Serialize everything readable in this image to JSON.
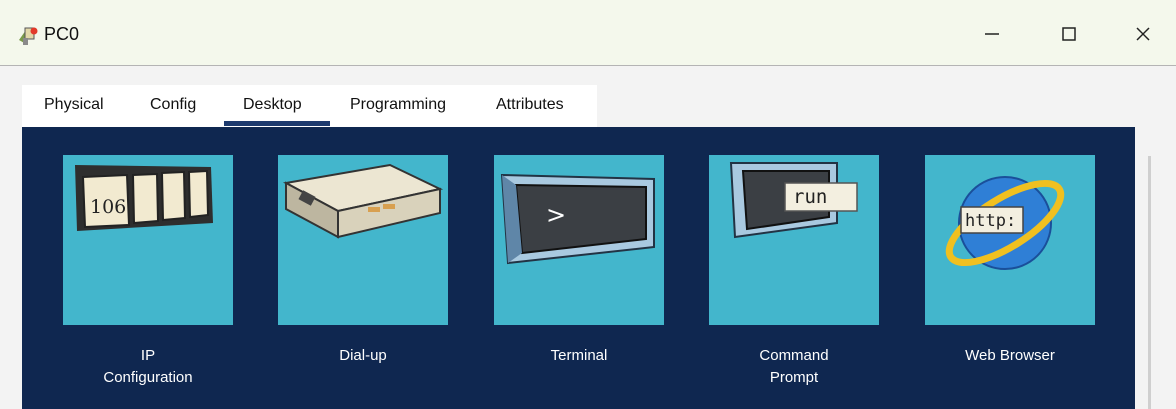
{
  "window": {
    "title": "PC0",
    "icon": "pc-device-icon",
    "controls": [
      "minimize-icon",
      "maximize-icon",
      "close-icon"
    ]
  },
  "tabs": [
    {
      "label": "Physical",
      "selected": false
    },
    {
      "label": "Config",
      "selected": false
    },
    {
      "label": "Desktop",
      "selected": true
    },
    {
      "label": "Programming",
      "selected": false
    },
    {
      "label": "Attributes",
      "selected": false
    }
  ],
  "desktop": {
    "apps": [
      {
        "id": "ip-config",
        "icon": "ip-configuration-icon",
        "icon_text": "106",
        "line1": "IP",
        "line2": "Configuration"
      },
      {
        "id": "dial-up",
        "icon": "dial-up-modem-icon",
        "line1": "Dial-up",
        "line2": ""
      },
      {
        "id": "terminal",
        "icon": "terminal-icon",
        "icon_text": ">",
        "line1": "Terminal",
        "line2": ""
      },
      {
        "id": "command-prompt",
        "icon": "command-prompt-icon",
        "icon_text": "run",
        "line1": "Command",
        "line2": "Prompt"
      },
      {
        "id": "web-browser",
        "icon": "web-browser-icon",
        "icon_text": "http:",
        "line1": "Web Browser",
        "line2": ""
      }
    ]
  },
  "colors": {
    "titlebar_bg": "#f4f8ec",
    "desktop_bg": "#0f2750",
    "tile_bg": "#43b6cc",
    "tab_underline": "#1d3a6e"
  }
}
